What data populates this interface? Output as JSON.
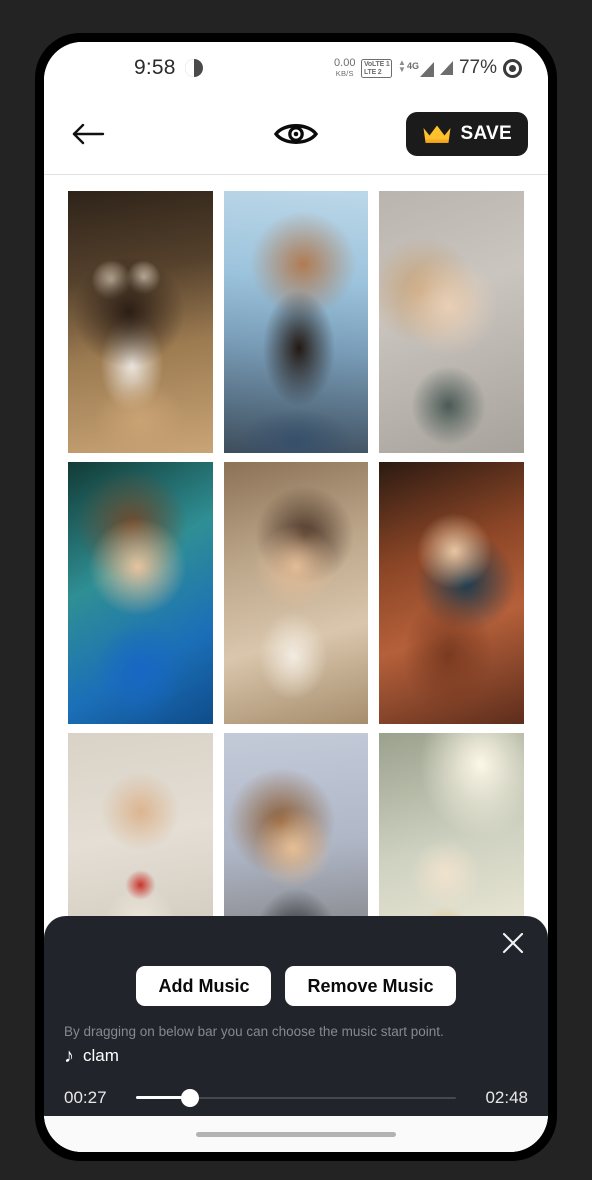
{
  "status_bar": {
    "time": "9:58",
    "alarm_icon": "alarm-icon",
    "net_speed_value": "0.00",
    "net_speed_unit": "KB/S",
    "volte_line1": "VoLTE 1",
    "volte_line2": "LTE 2",
    "network_type": "4G",
    "battery": "77%",
    "record_icon": "record-icon"
  },
  "toolbar": {
    "back_icon": "back-arrow-icon",
    "preview_icon": "eye-icon",
    "save_label": "SAVE",
    "crown_icon": "crown-icon",
    "save_bg": "#1b1b1b",
    "crown_color": "#FFC02E"
  },
  "grid": {
    "columns": 3,
    "photos": [
      {
        "id": "photo-1",
        "alt": "woman writing in notebook at cafe"
      },
      {
        "id": "photo-2",
        "alt": "woman with curly hair in black top outdoors"
      },
      {
        "id": "photo-3",
        "alt": "blonde woman against concrete wall"
      },
      {
        "id": "photo-4",
        "alt": "woman in blue dress with gold makeup"
      },
      {
        "id": "photo-5",
        "alt": "smiling woman in floral top in field"
      },
      {
        "id": "photo-6",
        "alt": "woman with dark hair in brown coat"
      },
      {
        "id": "photo-7",
        "alt": "woman in white suit holding red rose"
      },
      {
        "id": "photo-8",
        "alt": "woman in black jacket looking up"
      },
      {
        "id": "photo-9",
        "alt": "blonde woman laughing in sunlight"
      }
    ]
  },
  "music_panel": {
    "close_icon": "close-icon",
    "add_music_label": "Add Music",
    "remove_music_label": "Remove Music",
    "hint": "By dragging on below bar you can choose the music start point.",
    "note_icon": "music-note-icon",
    "track_name": "clam",
    "start_time": "00:27",
    "end_time": "02:48",
    "progress_percent": 17,
    "panel_bg": "#21242a"
  },
  "nav_bar": {
    "gesture_pill": "gesture-pill"
  }
}
